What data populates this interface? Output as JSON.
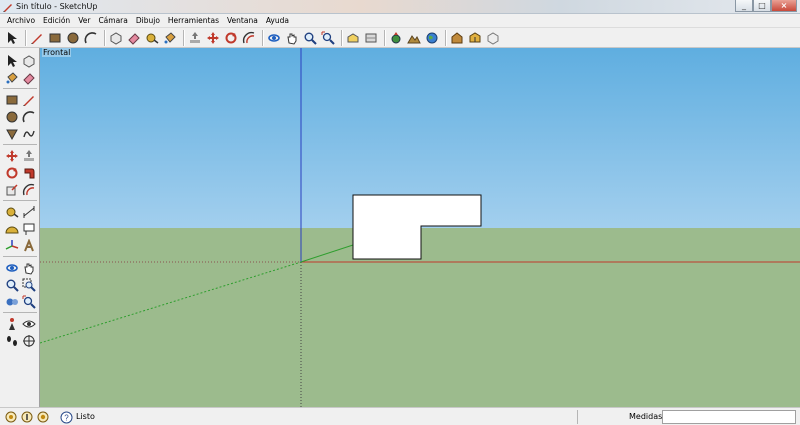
{
  "window": {
    "title": "Sin título - SketchUp"
  },
  "menu": [
    "Archivo",
    "Edición",
    "Ver",
    "Cámara",
    "Dibujo",
    "Herramientas",
    "Ventana",
    "Ayuda"
  ],
  "viewport": {
    "view_name": "Frontal"
  },
  "status": {
    "message": "Listo",
    "measure_label": "Medidas",
    "measure_value": ""
  },
  "colors": {
    "sky_top": "#5faee0",
    "ground": "#9cbb8d",
    "axis_red": "#c0392b",
    "axis_green": "#2e9e2e",
    "axis_blue": "#2a3fbf"
  }
}
